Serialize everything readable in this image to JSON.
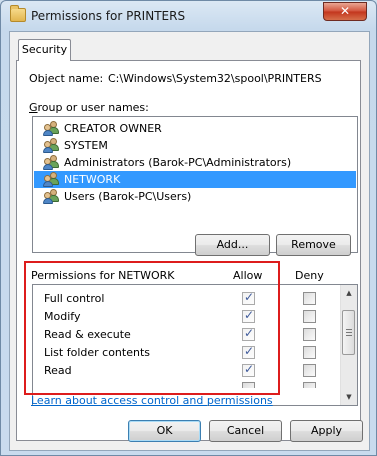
{
  "window": {
    "title": "Permissions for PRINTERS",
    "close_label": "✕"
  },
  "tab": {
    "label": "Security"
  },
  "object": {
    "label": "Object name:",
    "value": "C:\\Windows\\System32\\spool\\PRINTERS"
  },
  "groups": {
    "label": "Group or user names:",
    "items": [
      {
        "label": "CREATOR OWNER",
        "selected": false
      },
      {
        "label": "SYSTEM",
        "selected": false
      },
      {
        "label": "Administrators (Barok-PC\\Administrators)",
        "selected": false
      },
      {
        "label": "NETWORK",
        "selected": true
      },
      {
        "label": "Users (Barok-PC\\Users)",
        "selected": false
      }
    ]
  },
  "buttons": {
    "add": "Add...",
    "remove": "Remove",
    "ok": "OK",
    "cancel": "Cancel",
    "apply": "Apply"
  },
  "permissions": {
    "header": "Permissions for NETWORK",
    "allow_header": "Allow",
    "deny_header": "Deny",
    "rows": [
      {
        "label": "Full control",
        "allow": true,
        "deny": false
      },
      {
        "label": "Modify",
        "allow": true,
        "deny": false
      },
      {
        "label": "Read & execute",
        "allow": true,
        "deny": false
      },
      {
        "label": "List folder contents",
        "allow": true,
        "deny": false
      },
      {
        "label": "Read",
        "allow": true,
        "deny": false
      }
    ]
  },
  "link": {
    "label": "Learn about access control and permissions"
  },
  "colors": {
    "selection": "#3399ff",
    "highlight_border": "#dd1c1c",
    "link": "#0066cc"
  }
}
